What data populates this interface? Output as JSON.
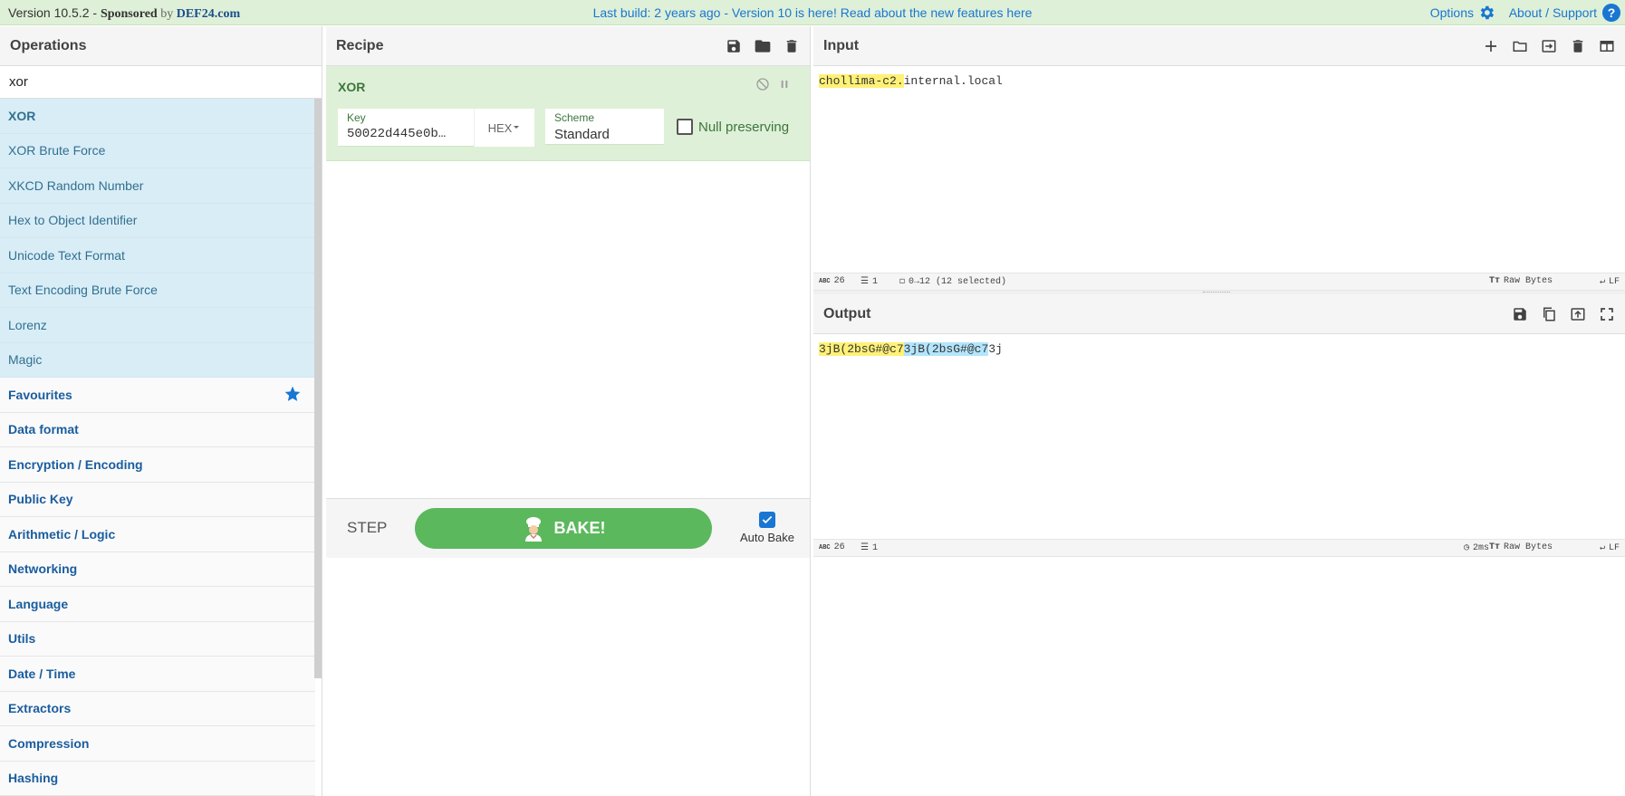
{
  "banner": {
    "version": "Version 10.5.2 - ",
    "sponsored": "Sponsored",
    "by": " by ",
    "brand": "DEF24.com",
    "notice": "Last build: 2 years ago - Version 10 is here! Read about the new features here",
    "options": "Options",
    "about": "About / Support",
    "help_glyph": "?"
  },
  "operations": {
    "title": "Operations",
    "search_value": "xor",
    "results": [
      "XOR",
      "XOR Brute Force",
      "XKCD Random Number",
      "Hex to Object Identifier",
      "Unicode Text Format",
      "Text Encoding Brute Force",
      "Lorenz",
      "Magic"
    ],
    "categories": [
      "Favourites",
      "Data format",
      "Encryption / Encoding",
      "Public Key",
      "Arithmetic / Logic",
      "Networking",
      "Language",
      "Utils",
      "Date / Time",
      "Extractors",
      "Compression",
      "Hashing"
    ]
  },
  "recipe": {
    "title": "Recipe",
    "op_name": "XOR",
    "key_label": "Key",
    "key_value": "50022d445e0b…",
    "key_format": "HEX",
    "scheme_label": "Scheme",
    "scheme_value": "Standard",
    "null_preserving": "Null preserving",
    "step": "STEP",
    "bake": "BAKE!",
    "auto_bake": "Auto Bake"
  },
  "input": {
    "title": "Input",
    "text_selected": "chollima-c2.",
    "text_rest": "internal.local",
    "length": "26",
    "lines": "1",
    "selection": "0→12 (12 selected)",
    "encoding": "Raw Bytes",
    "eol": "LF"
  },
  "output": {
    "title": "Output",
    "seg1": "3jB(2bsG#@c7",
    "seg2": "3jB(2bsG#@c7",
    "seg3": "3j",
    "length": "26",
    "lines": "1",
    "time": "2ms",
    "encoding": "Raw Bytes",
    "eol": "LF"
  },
  "colors": {
    "accent": "#1976d2",
    "bake": "#5cb85c",
    "recipe_bg": "#dff0d8",
    "op_highlight": "#d9edf7"
  }
}
